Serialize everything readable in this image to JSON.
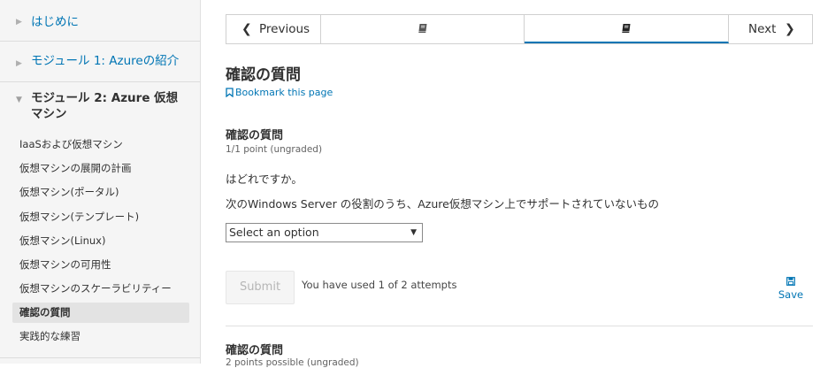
{
  "sidebar": {
    "sections": [
      {
        "title": "はじめに",
        "expanded": false
      },
      {
        "title": "モジュール 1: Azureの紹介",
        "expanded": false
      },
      {
        "title": "モジュール 2: Azure 仮想マシン",
        "expanded": true
      }
    ],
    "items": [
      {
        "label": "IaaSおよび仮想マシン"
      },
      {
        "label": "仮想マシンの展開の計画"
      },
      {
        "label": "仮想マシン(ポータル)"
      },
      {
        "label": "仮想マシン(テンプレート)"
      },
      {
        "label": "仮想マシン(Linux)"
      },
      {
        "label": "仮想マシンの可用性"
      },
      {
        "label": "仮想マシンのスケーラビリティー"
      },
      {
        "label": "確認の質問",
        "active": true
      },
      {
        "label": "実践的な練習"
      }
    ]
  },
  "nav": {
    "previous_label": "Previous",
    "next_label": "Next",
    "sequence_icons": [
      "book-icon",
      "book-icon"
    ],
    "active_index": 1
  },
  "content": {
    "page_title": "確認の質問",
    "bookmark_label": "Bookmark this page",
    "problem": {
      "title": "確認の質問",
      "points": "1/1 point (ungraded)",
      "question_line1": "はどれですか。",
      "question_line2": "次のWindows Server の役割のうち、Azure仮想マシン上でサポートされていないもの",
      "select_value": "Select an option",
      "submit_label": "Submit",
      "attempts_text": "You have used 1 of 2 attempts",
      "save_label": "Save"
    },
    "next_problem": {
      "title": "確認の質問",
      "points": "2 points possible (ungraded)"
    }
  },
  "colors": {
    "link": "#0075b4",
    "text": "#313131",
    "sidebar_bg": "#f5f5f5",
    "active_item_bg": "#e3e3e3"
  }
}
